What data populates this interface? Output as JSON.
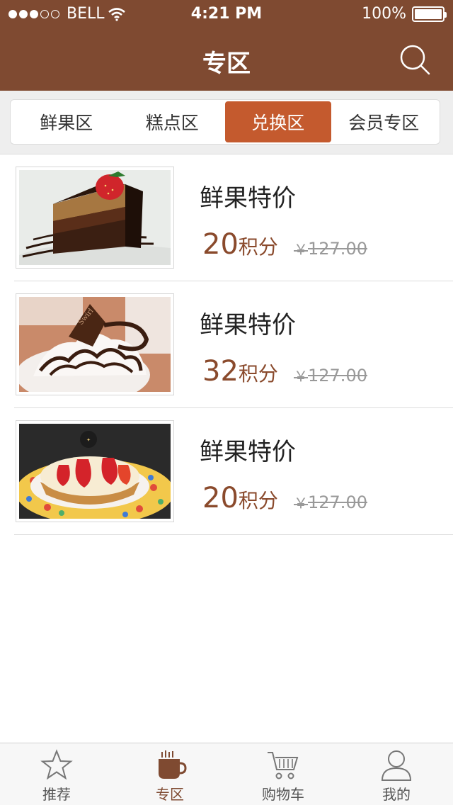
{
  "status_bar": {
    "carrier": "BELL",
    "time": "4:21 PM",
    "battery": "100%",
    "signal_dots_filled": 3,
    "signal_dots_total": 5
  },
  "header": {
    "title": "专区",
    "search_icon": "search-icon",
    "background": "#7f4a31"
  },
  "tabs": [
    {
      "label": "鲜果区",
      "active": false
    },
    {
      "label": "糕点区",
      "active": false
    },
    {
      "label": "兑换区",
      "active": true
    },
    {
      "label": "会员专区",
      "active": false
    }
  ],
  "items": [
    {
      "title": "鲜果特价",
      "points": "20",
      "points_unit": "积分",
      "currency": "￥",
      "original_price": "127.00",
      "image": "chocolate-cake-slice"
    },
    {
      "title": "鲜果特价",
      "points": "32",
      "points_unit": "积分",
      "currency": "￥",
      "original_price": "127.00",
      "image": "chocolate-cream-dessert"
    },
    {
      "title": "鲜果特价",
      "points": "20",
      "points_unit": "积分",
      "currency": "￥",
      "original_price": "127.00",
      "image": "strawberry-tart"
    }
  ],
  "bottom_nav": [
    {
      "label": "推荐",
      "icon": "star-icon",
      "active": false
    },
    {
      "label": "专区",
      "icon": "coffee-cup-icon",
      "active": true
    },
    {
      "label": "购物车",
      "icon": "shopping-cart-icon",
      "active": false
    },
    {
      "label": "我的",
      "icon": "user-icon",
      "active": false
    }
  ],
  "colors": {
    "brand": "#7f4a31",
    "active_tab": "#c45a2e",
    "price": "#8a4a2c"
  }
}
